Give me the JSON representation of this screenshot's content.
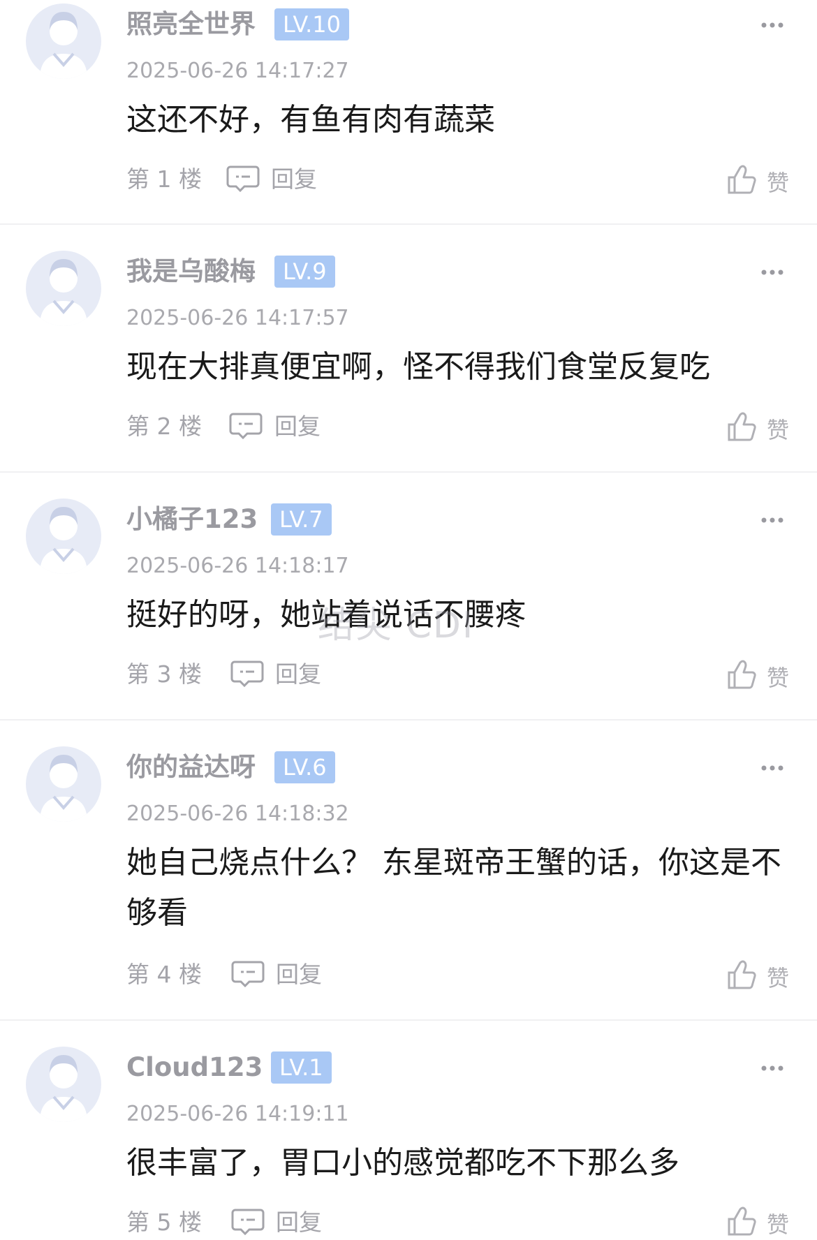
{
  "comments": [
    {
      "username": "照亮全世界",
      "level": "LV.10",
      "timestamp": "2025-06-26 14:17:27",
      "content": "这还不好，有鱼有肉有蔬菜",
      "floor": "第 1 楼",
      "reply_label": "回复",
      "like_label": "赞"
    },
    {
      "username": "我是乌酸梅",
      "level": "LV.9",
      "timestamp": "2025-06-26 14:17:57",
      "content": "现在大排真便宜啊，怪不得我们食堂反复吃",
      "floor": "第 2 楼",
      "reply_label": "回复",
      "like_label": "赞"
    },
    {
      "username": "小橘子123",
      "level": "LV.7",
      "timestamp": "2025-06-26 14:18:17",
      "content": "挺好的呀，她站着说话不腰疼",
      "floor": "第 3 楼",
      "reply_label": "回复",
      "like_label": "赞"
    },
    {
      "username": "你的益达呀",
      "level": "LV.6",
      "timestamp": "2025-06-26 14:18:32",
      "content": "她自己烧点什么？ 东星斑帝王蟹的话，你这是不够看",
      "floor": "第 4 楼",
      "reply_label": "回复",
      "like_label": "赞"
    },
    {
      "username": "Cloud123",
      "level": "LV.1",
      "timestamp": "2025-06-26 14:19:11",
      "content": "很丰富了，胃口小的感觉都吃不下那么多",
      "floor": "第 5 楼",
      "reply_label": "回复",
      "like_label": "赞"
    }
  ],
  "watermark": "结尖 CDI",
  "colors": {
    "level_badge": "#a9c8f5",
    "username": "#9a9aa0",
    "timestamp": "#a9a9ae",
    "content": "#1a1a1a",
    "divider": "#f0f0f2",
    "avatar_bg": "#e7ebf6"
  },
  "icons": {
    "avatar": "default-avatar-icon",
    "more": "more-dots-icon",
    "reply": "comment-bubble-icon",
    "like": "thumbs-up-icon"
  }
}
